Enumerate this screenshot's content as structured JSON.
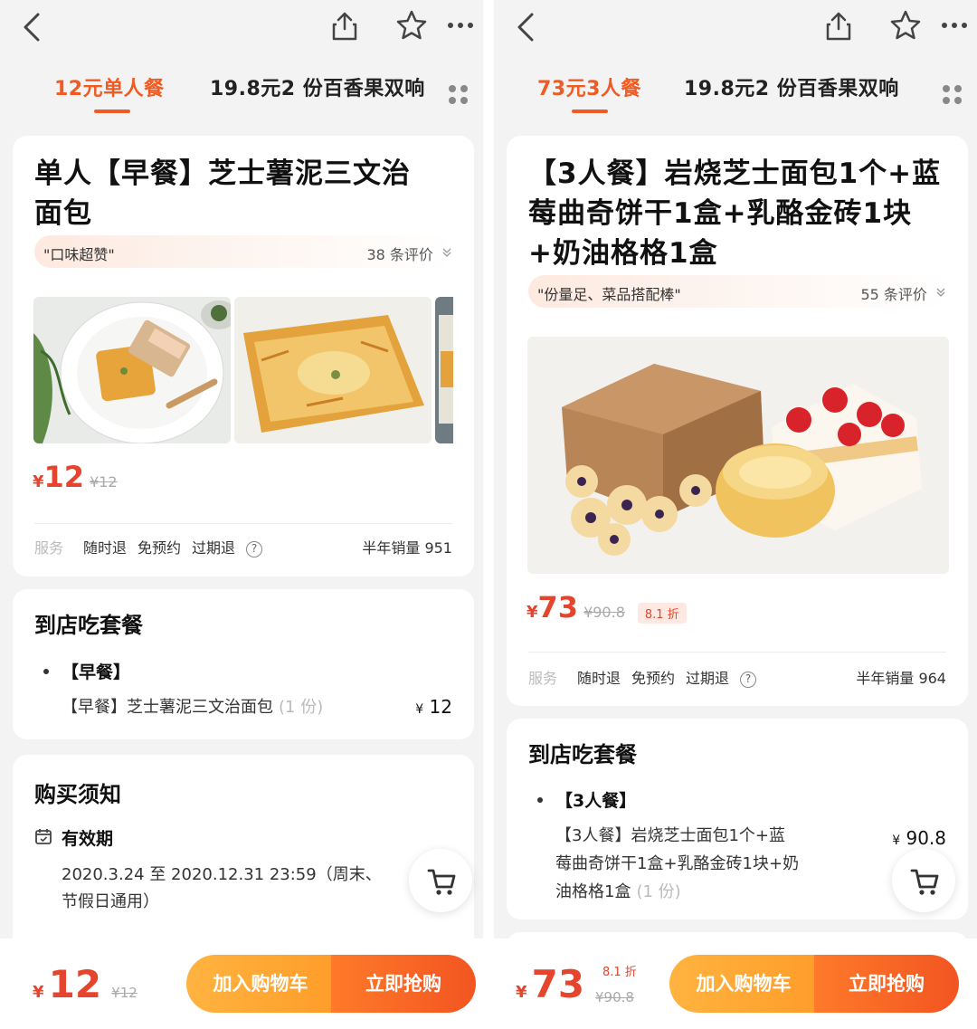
{
  "left": {
    "tabs": [
      {
        "label": "12元单人餐",
        "active": true
      },
      {
        "label": "19.8元2 份百香果双响",
        "active": false
      }
    ],
    "product": {
      "title_line1": "单人【早餐】芝士薯泥三文治",
      "title_line2": "面包",
      "review_quote": "\"口味超赞\"",
      "review_count": "38 条评价",
      "price_symbol": "¥",
      "price": "12",
      "original_price": "¥12"
    },
    "service": {
      "label": "服务",
      "items": [
        "随时退",
        "免预约",
        "过期退"
      ],
      "sales": "半年销量 951"
    },
    "package": {
      "section_title": "到店吃套餐",
      "group_name": "【早餐】",
      "item_name": "【早餐】芝士薯泥三文治面包",
      "item_qty": "(1 份)",
      "item_price_symbol": "¥",
      "item_price": "12"
    },
    "notice": {
      "section_title": "购买须知",
      "validity_label": "有效期",
      "validity_line1": "2020.3.24 至 2020.12.31 23:59（周末、",
      "validity_line2": "节假日通用）"
    },
    "bottom": {
      "price_symbol": "¥",
      "price": "12",
      "original_price": "¥12",
      "add_cart_label": "加入购物车",
      "buy_now_label": "立即抢购"
    }
  },
  "right": {
    "tabs": [
      {
        "label": "73元3人餐",
        "active": true
      },
      {
        "label": "19.8元2 份百香果双响",
        "active": false
      }
    ],
    "product": {
      "title_line1": "【3人餐】岩烧芝士面包1个+蓝",
      "title_line2": "莓曲奇饼干1盒+乳酪金砖1块",
      "title_line3": "+奶油格格1盒",
      "review_quote": "\"份量足、菜品搭配棒\"",
      "review_count": "55 条评价",
      "price_symbol": "¥",
      "price": "73",
      "original_price": "¥90.8",
      "discount": "8.1 折"
    },
    "service": {
      "label": "服务",
      "items": [
        "随时退",
        "免预约",
        "过期退"
      ],
      "sales": "半年销量 964"
    },
    "package": {
      "section_title": "到店吃套餐",
      "group_name": "【3人餐】",
      "item_line1": "【3人餐】岩烧芝士面包1个+蓝",
      "item_line2": "莓曲奇饼干1盒+乳酪金砖1块+奶",
      "item_line3": "油格格1盒",
      "item_qty": "(1 份)",
      "item_price_symbol": "¥",
      "item_price": "90.8"
    },
    "bottom": {
      "price_symbol": "¥",
      "price": "73",
      "discount": "8.1 折",
      "original_price": "¥90.8",
      "add_cart_label": "加入购物车",
      "buy_now_label": "立即抢购"
    }
  },
  "colors": {
    "accent": "#f05a23",
    "price": "#e5452d",
    "cart_button": "#ff9d2a",
    "buy_button": "#f25521",
    "background": "#f3f3f3"
  },
  "icons": [
    "back-icon",
    "share-icon",
    "star-icon",
    "more-icon",
    "grid-icon",
    "chevron-down-icon",
    "help-circle-icon",
    "calendar-icon",
    "cart-icon"
  ]
}
